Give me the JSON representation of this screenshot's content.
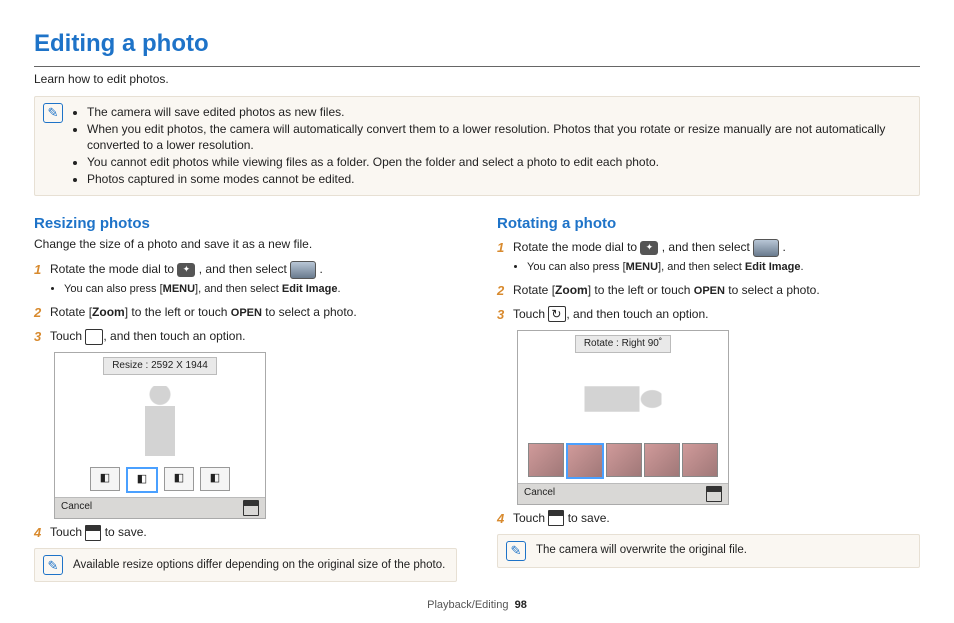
{
  "title": "Editing a photo",
  "intro": "Learn how to edit photos.",
  "top_notes": [
    "The camera will save edited photos as new files.",
    "When you edit photos, the camera will automatically convert them to a lower resolution. Photos that you rotate or resize manually are not automatically converted to a lower resolution.",
    "You cannot edit photos while viewing files as a folder. Open the folder and select a photo to edit each photo.",
    "Photos captured in some modes cannot be edited."
  ],
  "left": {
    "heading": "Resizing photos",
    "sub": "Change the size of a photo and save it as a new file.",
    "step1_a": "Rotate the mode dial to ",
    "step1_b": ", and then select ",
    "step1_c": ".",
    "step1_sub_a": "You can also press [",
    "step1_sub_menu": "MENU",
    "step1_sub_b": "], and then select ",
    "step1_sub_bold": "Edit Image",
    "step1_sub_c": ".",
    "step2_a": "Rotate [",
    "step2_zoom": "Zoom",
    "step2_b": "] to the left or touch ",
    "step2_open": "OPEN",
    "step2_c": " to select a photo.",
    "step3_a": "Touch ",
    "step3_b": ", and then touch an option.",
    "mock_label": "Resize : 2592 X 1944",
    "mock_cancel": "Cancel",
    "step4_a": "Touch ",
    "step4_b": " to save.",
    "note": "Available resize options differ depending on the original size of the photo."
  },
  "right": {
    "heading": "Rotating a photo",
    "step1_a": "Rotate the mode dial to ",
    "step1_b": ", and then select ",
    "step1_c": ".",
    "step1_sub_a": "You can also press [",
    "step1_sub_menu": "MENU",
    "step1_sub_b": "], and then select ",
    "step1_sub_bold": "Edit Image",
    "step1_sub_c": ".",
    "step2_a": "Rotate [",
    "step2_zoom": "Zoom",
    "step2_b": "] to the left or touch ",
    "step2_open": "OPEN",
    "step2_c": " to select a photo.",
    "step3_a": "Touch ",
    "step3_b": ", and then touch an option.",
    "mock_label": "Rotate : Right 90˚",
    "mock_cancel": "Cancel",
    "step4_a": "Touch ",
    "step4_b": " to save.",
    "note": "The camera will overwrite the original file."
  },
  "footer_section": "Playback/Editing",
  "footer_page": "98"
}
